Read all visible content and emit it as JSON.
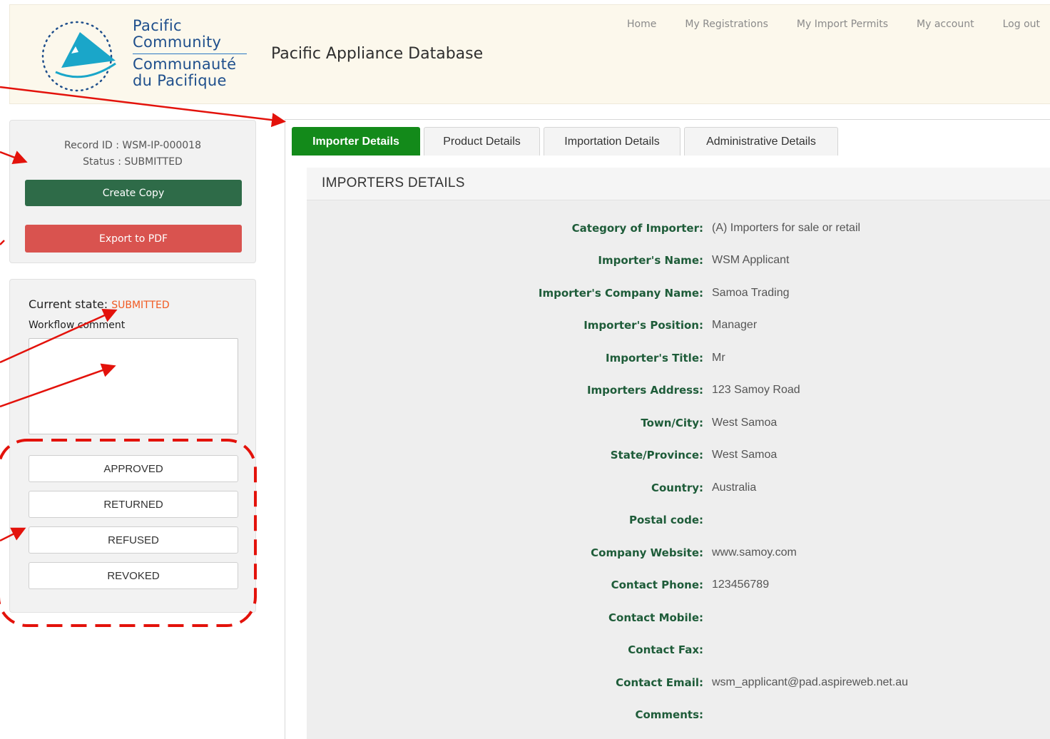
{
  "header": {
    "logo": {
      "line1": "Pacific",
      "line2": "Community",
      "line3": "Communauté",
      "line4": "du Pacifique"
    },
    "site_title": "Pacific Appliance Database",
    "nav": [
      "Home",
      "My Registrations",
      "My Import Permits",
      "My account",
      "Log out"
    ]
  },
  "record": {
    "record_id_text": "Record ID : WSM-IP-000018",
    "status_text": "Status : SUBMITTED",
    "create_copy_label": "Create Copy",
    "export_pdf_label": "Export to PDF"
  },
  "workflow": {
    "current_state_label": "Current state:",
    "current_state_value": "SUBMITTED",
    "comment_label": "Workflow comment",
    "comment_value": "",
    "actions": [
      "APPROVED",
      "RETURNED",
      "REFUSED",
      "REVOKED"
    ]
  },
  "tabs": [
    "Importer Details",
    "Product Details",
    "Importation Details",
    "Administrative Details"
  ],
  "active_tab": "Importer Details",
  "section_title": "IMPORTERS DETAILS",
  "fields": [
    {
      "label": "Category of Importer:",
      "value": "(A) Importers for sale or retail"
    },
    {
      "label": "Importer's Name:",
      "value": "WSM Applicant"
    },
    {
      "label": "Importer's Company Name:",
      "value": "Samoa Trading"
    },
    {
      "label": "Importer's Position:",
      "value": "Manager"
    },
    {
      "label": "Importer's Title:",
      "value": "Mr"
    },
    {
      "label": "Importers Address:",
      "value": "123 Samoy Road"
    },
    {
      "label": "Town/City:",
      "value": "West Samoa"
    },
    {
      "label": "State/Province:",
      "value": "West Samoa"
    },
    {
      "label": "Country:",
      "value": "Australia"
    },
    {
      "label": "Postal code:",
      "value": ""
    },
    {
      "label": "Company Website:",
      "value": "www.samoy.com"
    },
    {
      "label": "Contact Phone:",
      "value": "123456789"
    },
    {
      "label": "Contact Mobile:",
      "value": ""
    },
    {
      "label": "Contact Fax:",
      "value": ""
    },
    {
      "label": "Contact Email:",
      "value": "wsm_applicant@pad.aspireweb.net.au"
    },
    {
      "label": "Comments:",
      "value": ""
    }
  ],
  "colors": {
    "header_bg": "#fcf8ec",
    "active_tab": "#138a1a",
    "create_copy": "#2e6b48",
    "export_pdf": "#d9534f",
    "state_value": "#f15a22",
    "field_label": "#1e5c39",
    "annotation": "#e3120b"
  }
}
